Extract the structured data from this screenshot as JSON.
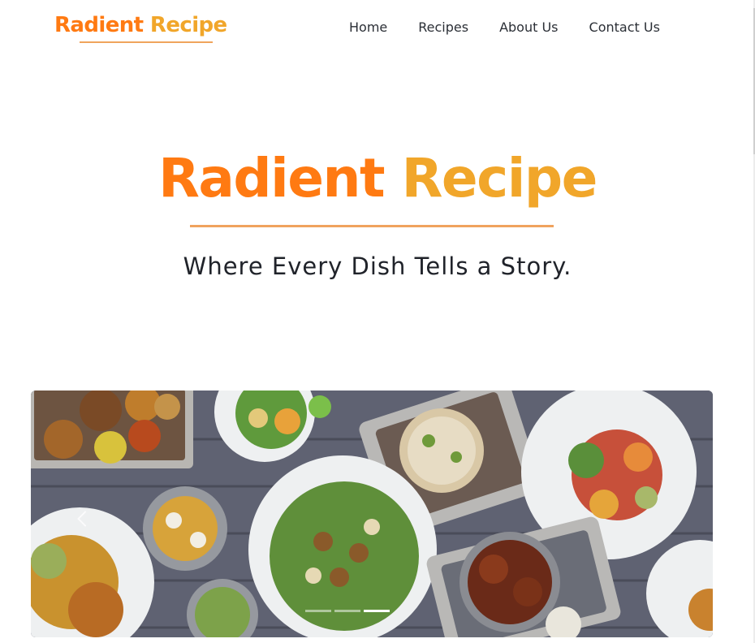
{
  "brand": {
    "word1": "Radient",
    "word2": "Recipe"
  },
  "nav": {
    "items": [
      {
        "label": "Home"
      },
      {
        "label": "Recipes"
      },
      {
        "label": "About Us"
      },
      {
        "label": "Contact Us"
      }
    ]
  },
  "hero": {
    "title_word1": "Radient",
    "title_word2": "Recipe",
    "tagline": "Where Every Dish Tells a Story."
  },
  "carousel": {
    "active_slide": 2,
    "slide_count": 3
  },
  "colors": {
    "accent_orange": "#ff7a12",
    "accent_gold": "#f1a62a",
    "underline": "#f0a45c"
  }
}
